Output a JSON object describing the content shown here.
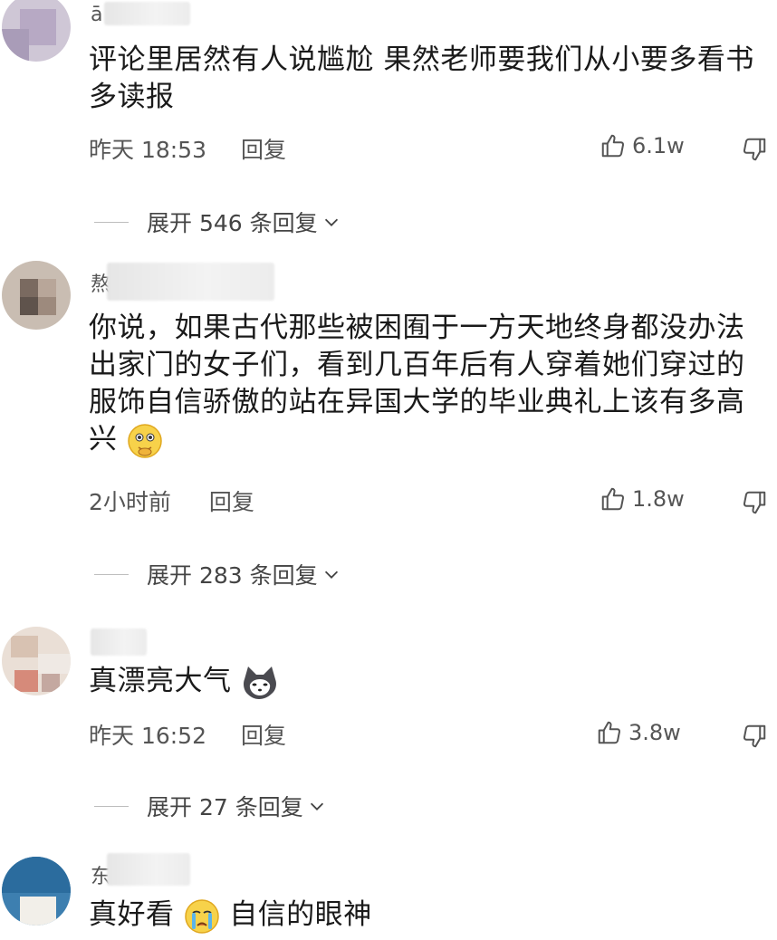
{
  "comments": [
    {
      "username": "ā",
      "content": "评论里居然有人说尴尬 果然老师要我们从小要多看书多读报",
      "time": "昨天 18:53",
      "reply": "回复",
      "likes": "6.1w",
      "expand": "展开 546 条回复"
    },
    {
      "username": "熬",
      "content": "你说，如果古代那些被困囿于一方天地终身都没办法出家门的女子们，看到几百年后有人穿着她们穿过的服饰自信骄傲的站在异国大学的毕业典礼上该有多高兴",
      "time": "2小时前",
      "reply": "回复",
      "likes": "1.8w",
      "expand": "展开 283 条回复"
    },
    {
      "username": "",
      "content": "真漂亮大气",
      "time": "昨天 16:52",
      "reply": "回复",
      "likes": "3.8w",
      "expand": "展开 27 条回复"
    },
    {
      "username": "东",
      "content_a": "真好看",
      "content_b": "自信的眼神"
    }
  ],
  "icons": {
    "like": "thumbs-up-icon",
    "dislike": "thumbs-down-icon",
    "expand": "chevron-down-icon"
  }
}
